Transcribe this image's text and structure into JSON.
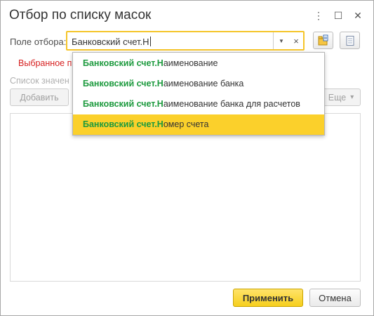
{
  "window": {
    "title": "Отбор по списку масок",
    "more_icon": "⋮",
    "maximize_icon": "☐",
    "close_icon": "✕"
  },
  "filter": {
    "label": "Поле отбора:",
    "value": "Банковский счет.Н",
    "dropdown_icon": "▼",
    "clear_icon": "×"
  },
  "selected_notice": "Выбранное п",
  "list_caption": "Список значен",
  "buttons": {
    "add": "Добавить",
    "more": "Еще",
    "more_arrow": "▾",
    "apply": "Применить",
    "cancel": "Отмена"
  },
  "suggestions": [
    {
      "prefix": "Банковский счет.Н",
      "rest": "аименование",
      "selected": false
    },
    {
      "prefix": "Банковский счет.Н",
      "rest": "аименование банка",
      "selected": false
    },
    {
      "prefix": "Банковский счет.Н",
      "rest": "аименование банка для расчетов",
      "selected": false
    },
    {
      "prefix": "Банковский счет.Н",
      "rest": "омер счета",
      "selected": true
    }
  ],
  "colors": {
    "accent": "#fbd02b",
    "highlight_text": "#1d9a3e",
    "warning_text": "#d61f1f"
  }
}
